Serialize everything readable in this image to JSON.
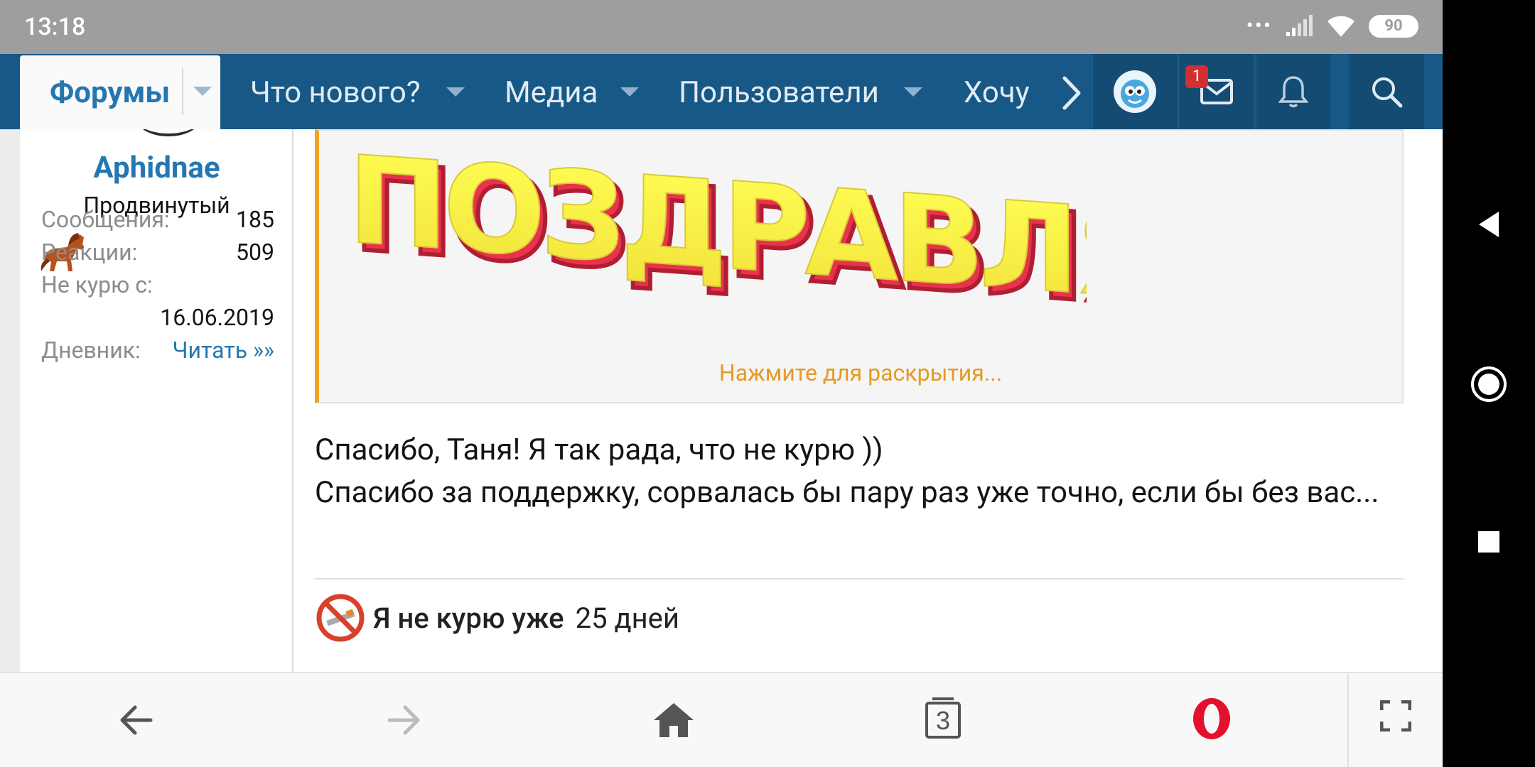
{
  "status_bar": {
    "time": "13:18",
    "battery": "90",
    "icons": [
      "more-dots-icon",
      "signal-icon",
      "wifi-icon",
      "battery-icon"
    ]
  },
  "forum_nav": {
    "active_item": "Форумы",
    "items": [
      {
        "label": "Что нового?"
      },
      {
        "label": "Медиа"
      },
      {
        "label": "Пользователи"
      },
      {
        "label": "Хочу"
      }
    ],
    "inbox_badge": "1"
  },
  "user": {
    "name": "Aphidnae",
    "title": "Продвинутый",
    "stats": [
      {
        "label": "Сообщения:",
        "value": "185"
      },
      {
        "label": "Реакции:",
        "value": "509"
      },
      {
        "label": "Не курю с:",
        "value": "16.06.2019"
      },
      {
        "label": "Дневник:",
        "value": "Читать »»"
      }
    ]
  },
  "post": {
    "quote_banner": "ПОЗДРАВЛЯЕМ!",
    "quote_expand": "Нажмите для раскрытия...",
    "lines": [
      "Спасибо, Таня! Я так рада, что не курю ))",
      "Спасибо за поддержку, сорвалась бы пару раз уже точно, если бы без вас..."
    ],
    "signature_text": "Я не курю уже",
    "signature_days": "25 дней"
  },
  "browser_bar": {
    "tabs_count": "3"
  },
  "colors": {
    "nav_bg": "#185886",
    "accent_blue": "#2577b1",
    "quote_accent": "#f0a322",
    "badge_red": "#d32f2f"
  }
}
